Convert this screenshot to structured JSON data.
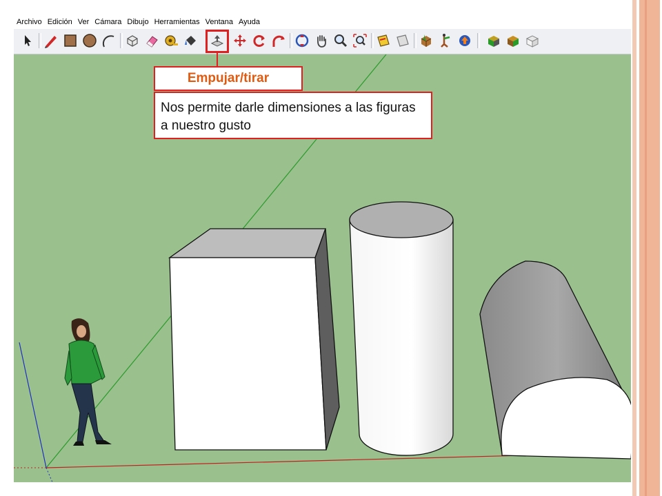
{
  "menu": [
    "Archivo",
    "Edición",
    "Ver",
    "Cámara",
    "Dibujo",
    "Herramientas",
    "Ventana",
    "Ayuda"
  ],
  "toolbar": {
    "tools": [
      {
        "name": "select-tool-icon"
      },
      {
        "name": "pencil-tool-icon"
      },
      {
        "name": "rectangle-tool-icon"
      },
      {
        "name": "circle-tool-icon"
      },
      {
        "name": "arc-tool-icon"
      },
      {
        "name": "make-component-tool-icon"
      },
      {
        "name": "eraser-tool-icon"
      },
      {
        "name": "tape-measure-tool-icon"
      },
      {
        "name": "paint-bucket-tool-icon"
      },
      {
        "name": "push-pull-tool-icon"
      },
      {
        "name": "move-tool-icon"
      },
      {
        "name": "rotate-tool-icon"
      },
      {
        "name": "follow-me-tool-icon"
      },
      {
        "name": "orbit-tool-icon"
      },
      {
        "name": "pan-tool-icon"
      },
      {
        "name": "zoom-tool-icon"
      },
      {
        "name": "zoom-extents-tool-icon"
      },
      {
        "name": "section-plane-tool-icon"
      },
      {
        "name": "display-section-tool-icon"
      },
      {
        "name": "get-models-tool-icon"
      },
      {
        "name": "walk-tool-icon"
      },
      {
        "name": "share-model-tool-icon"
      },
      {
        "name": "get-photo-texture-tool-icon"
      },
      {
        "name": "add-location-tool-icon"
      },
      {
        "name": "toggle-terrain-tool-icon"
      }
    ]
  },
  "callout": {
    "title": "Empujar/tirar",
    "description": "Nos permite darle dimensiones a las figuras a nuestro gusto"
  },
  "colors": {
    "viewport": "#9ac08e",
    "accent": "#e02020",
    "title_text": "#e05a10"
  }
}
